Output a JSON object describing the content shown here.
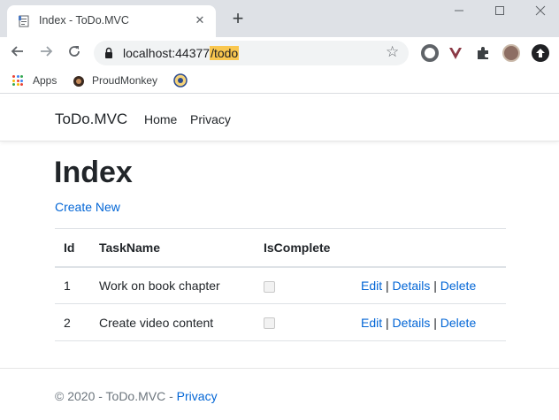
{
  "browser": {
    "tab_title": "Index - ToDo.MVC",
    "tab_close": "✕",
    "new_tab": "+",
    "url_host": "localhost:44377",
    "url_path": "/todo",
    "bookmarks": [
      {
        "label": "Apps",
        "icon": "apps-grid-icon"
      },
      {
        "label": "ProudMonkey",
        "icon": "monkey-icon"
      },
      {
        "label": "",
        "icon": "seal-icon"
      }
    ],
    "extensions": [
      "opera-icon",
      "vivaldi-icon",
      "puzzle-icon",
      "profile-avatar",
      "upload-icon"
    ],
    "colors": {
      "accent_highlight": "#f9c74f",
      "titlebar": "#dee1e6"
    }
  },
  "navbar": {
    "brand": "ToDo.MVC",
    "links": [
      "Home",
      "Privacy"
    ]
  },
  "main": {
    "title": "Index",
    "create_new": "Create New",
    "table": {
      "headers": [
        "Id",
        "TaskName",
        "IsComplete",
        ""
      ],
      "rows": [
        {
          "id": "1",
          "task": "Work on book chapter",
          "complete": false
        },
        {
          "id": "2",
          "task": "Create video content",
          "complete": false
        }
      ],
      "actions": {
        "edit": "Edit",
        "details": "Details",
        "delete": "Delete",
        "separator": "|"
      }
    }
  },
  "footer": {
    "text": "© 2020 - ToDo.MVC -",
    "link": "Privacy"
  },
  "colors": {
    "link": "#0366d6"
  }
}
